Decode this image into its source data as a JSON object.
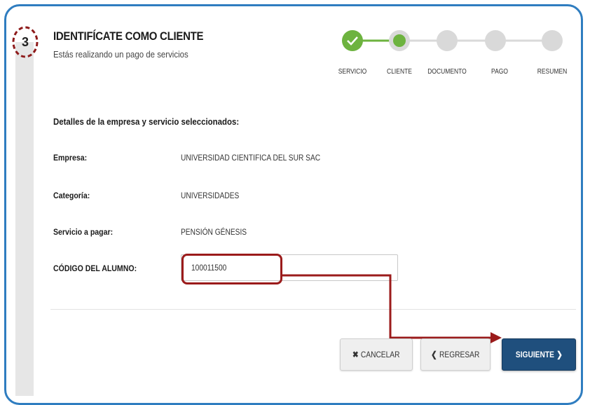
{
  "step": {
    "number": "3",
    "title": "IDENTIFÍCATE COMO CLIENTE",
    "subtitle": "Estás realizando un pago de servicios"
  },
  "stepper": {
    "steps": [
      {
        "label": "SERVICIO",
        "state": "done"
      },
      {
        "label": "CLIENTE",
        "state": "current"
      },
      {
        "label": "DOCUMENTO",
        "state": "pending"
      },
      {
        "label": "PAGO",
        "state": "pending"
      },
      {
        "label": "RESUMEN",
        "state": "pending"
      }
    ],
    "colors": {
      "active": "#6db33f",
      "pending": "#d9d9d9"
    }
  },
  "details": {
    "section_title": "Detalles de la empresa y servicio seleccionados:",
    "rows": [
      {
        "label": "Empresa:",
        "value": "UNIVERSIDAD CIENTIFICA DEL SUR SAC"
      },
      {
        "label": "Categoría:",
        "value": "UNIVERSIDADES"
      },
      {
        "label": "Servicio a pagar:",
        "value": "PENSIÓN GÉNESIS"
      }
    ]
  },
  "code_field": {
    "label": "CÓDIGO DEL ALUMNO:",
    "value": "100011500"
  },
  "buttons": {
    "cancel": "CANCELAR",
    "cancel_icon": "✖",
    "back": "REGRESAR",
    "back_icon": "❮",
    "next": "SIGUIENTE",
    "next_icon": "❯"
  },
  "colors": {
    "frame": "#2f7dc0",
    "highlight": "#9b1b1b",
    "primary_button": "#1f4f7d"
  }
}
